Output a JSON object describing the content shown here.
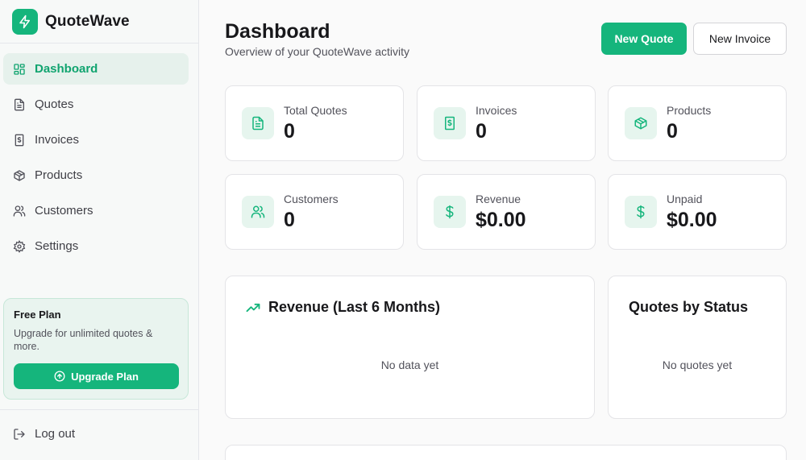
{
  "brand": {
    "name": "QuoteWave",
    "icon": "bolt-icon",
    "accent": "#15b57c"
  },
  "sidebar": {
    "items": [
      {
        "label": "Dashboard",
        "icon": "dashboard-grid-icon",
        "active": true
      },
      {
        "label": "Quotes",
        "icon": "document-icon",
        "active": false
      },
      {
        "label": "Invoices",
        "icon": "receipt-dollar-icon",
        "active": false
      },
      {
        "label": "Products",
        "icon": "box-icon",
        "active": false
      },
      {
        "label": "Customers",
        "icon": "users-icon",
        "active": false
      },
      {
        "label": "Settings",
        "icon": "gear-icon",
        "active": false
      }
    ],
    "plan": {
      "title": "Free Plan",
      "description": "Upgrade for unlimited quotes & more.",
      "button_label": "Upgrade Plan"
    },
    "logout_label": "Log out"
  },
  "header": {
    "title": "Dashboard",
    "subtitle": "Overview of your QuoteWave activity",
    "new_quote_label": "New Quote",
    "new_invoice_label": "New Invoice"
  },
  "stats": [
    {
      "label": "Total Quotes",
      "value": "0",
      "icon": "document-icon"
    },
    {
      "label": "Invoices",
      "value": "0",
      "icon": "receipt-dollar-icon"
    },
    {
      "label": "Products",
      "value": "0",
      "icon": "box-icon"
    },
    {
      "label": "Customers",
      "value": "0",
      "icon": "users-icon"
    },
    {
      "label": "Revenue",
      "value": "$0.00",
      "icon": "dollar-icon"
    },
    {
      "label": "Unpaid",
      "value": "$0.00",
      "icon": "dollar-icon"
    }
  ],
  "panels": {
    "revenue": {
      "title": "Revenue (Last 6 Months)",
      "empty_text": "No data yet",
      "icon": "trending-up-icon"
    },
    "status": {
      "title": "Quotes by Status",
      "empty_text": "No quotes yet"
    }
  }
}
